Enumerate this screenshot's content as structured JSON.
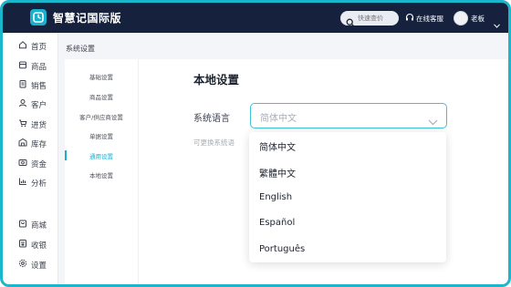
{
  "app": {
    "title": "智慧记国际版"
  },
  "header": {
    "search_placeholder": "快速查价",
    "service_label": "在线客服",
    "user_name": "老板"
  },
  "sidebar": {
    "items": [
      {
        "label": "首页",
        "icon": "home-icon"
      },
      {
        "label": "商品",
        "icon": "box-icon"
      },
      {
        "label": "销售",
        "icon": "receipt-icon"
      },
      {
        "label": "客户",
        "icon": "user-icon"
      },
      {
        "label": "进货",
        "icon": "cart-icon"
      },
      {
        "label": "库存",
        "icon": "warehouse-icon"
      },
      {
        "label": "资金",
        "icon": "money-icon"
      },
      {
        "label": "分析",
        "icon": "chart-icon"
      }
    ],
    "bottom_items": [
      {
        "label": "商城",
        "icon": "shop-icon"
      },
      {
        "label": "收银",
        "icon": "cashier-icon"
      },
      {
        "label": "设置",
        "icon": "gear-icon"
      }
    ]
  },
  "section": {
    "title": "系统设置"
  },
  "settings_menu": {
    "items": [
      "基础设置",
      "商品设置",
      "客户/供应商设置",
      "单据设置",
      "通用设置",
      "本地设置"
    ],
    "active_index": 4
  },
  "main": {
    "title": "本地设置",
    "language_label": "系统语言",
    "language_value": "简体中文",
    "hint": "可更换系统语"
  },
  "dropdown": {
    "options": [
      "简体中文",
      "繁體中文",
      "English",
      "Español",
      "Português"
    ]
  },
  "colors": {
    "header_bg": "#15213d",
    "accent": "#18b0cf",
    "frame_border": "#19b6cc"
  }
}
